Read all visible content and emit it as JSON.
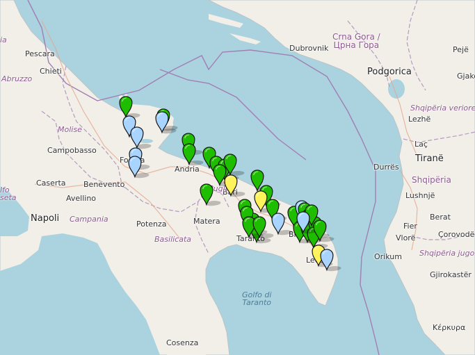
{
  "map": {
    "places": [
      {
        "name": "pescara-label",
        "text": "Pescara",
        "cls": "city"
      },
      {
        "name": "chieti-label",
        "text": "Chieti",
        "cls": "city"
      },
      {
        "name": "campobasso-label",
        "text": "Campobasso",
        "cls": "city"
      },
      {
        "name": "caserta-label",
        "text": "Caserta",
        "cls": "city"
      },
      {
        "name": "benevento-label",
        "text": "Benevento",
        "cls": "city"
      },
      {
        "name": "avellino-label",
        "text": "Avellino",
        "cls": "city"
      },
      {
        "name": "napoli-label",
        "text": "Napoli",
        "cls": "city-big"
      },
      {
        "name": "potenza-label",
        "text": "Potenza",
        "cls": "city"
      },
      {
        "name": "matera-label",
        "text": "Matera",
        "cls": "city"
      },
      {
        "name": "foggia-label",
        "text": "Foggia",
        "cls": "city"
      },
      {
        "name": "andria-label",
        "text": "Andria",
        "cls": "city"
      },
      {
        "name": "bari-label",
        "text": "Bari",
        "cls": "city"
      },
      {
        "name": "taranto-label",
        "text": "Taranto",
        "cls": "city"
      },
      {
        "name": "brindisi-label",
        "text": "Brindisi",
        "cls": "city"
      },
      {
        "name": "lecce-label",
        "text": "Lecce",
        "cls": "city"
      },
      {
        "name": "cosenza-label",
        "text": "Cosenza",
        "cls": "city"
      },
      {
        "name": "dubrovnik-label",
        "text": "Dubrovnik",
        "cls": "city"
      },
      {
        "name": "podgorica-label",
        "text": "Podgorica",
        "cls": "city-big"
      },
      {
        "name": "peje-label",
        "text": "Pejë",
        "cls": "city"
      },
      {
        "name": "gjakove-label",
        "text": "Gjakov",
        "cls": "city"
      },
      {
        "name": "lezhe-label",
        "text": "Lezhë",
        "cls": "city"
      },
      {
        "name": "lac-label",
        "text": "Laç",
        "cls": "city"
      },
      {
        "name": "durres-label",
        "text": "Durrës",
        "cls": "city"
      },
      {
        "name": "tirane-label",
        "text": "Tiranë",
        "cls": "city-big"
      },
      {
        "name": "lushnje-label",
        "text": "Lushnjë",
        "cls": "city"
      },
      {
        "name": "fier-label",
        "text": "Fier",
        "cls": "city"
      },
      {
        "name": "berat-label",
        "text": "Berat",
        "cls": "city"
      },
      {
        "name": "vlore-label",
        "text": "Vlorë",
        "cls": "city"
      },
      {
        "name": "corovode-label",
        "text": "Çorovodë",
        "cls": "city"
      },
      {
        "name": "orikum-label",
        "text": "Orikum",
        "cls": "city"
      },
      {
        "name": "gjirokaster-label",
        "text": "Gjirokastër",
        "cls": "city"
      },
      {
        "name": "kerkyra-label",
        "text": "Κέρκυρα",
        "cls": "city"
      }
    ],
    "regions": [
      {
        "name": "abruzzo-label",
        "text": "Abruzzo"
      },
      {
        "name": "molise-label",
        "text": "Molise"
      },
      {
        "name": "campania-label",
        "text": "Campania"
      },
      {
        "name": "basilicata-label",
        "text": "Basilicata"
      },
      {
        "name": "puglia-label",
        "text": "Puglia"
      },
      {
        "name": "shqiperia-veriore-label",
        "text": "Shqipëria veriore"
      },
      {
        "name": "shqiperia-jugore-label",
        "text": "Shqipëria jugore"
      },
      {
        "name": "lazio-fragment-label",
        "text": "ia"
      },
      {
        "name": "tyrrhenian-fragment-label",
        "text": "lfo\nseta"
      }
    ],
    "countries": [
      {
        "name": "montenegro-label",
        "text": "Crna Gora /\nЦрна Гора"
      },
      {
        "name": "albania-label",
        "text": "Shqipëria"
      }
    ],
    "seas": [
      {
        "name": "gulf-of-taranto-label",
        "text": "Golfo di\nTaranto"
      }
    ],
    "marker_colors": {
      "green": "#1fbd00",
      "lightblue": "#a8d4ff",
      "yellow": "#fff35c"
    },
    "markers": [
      {
        "color": "green"
      },
      {
        "color": "green"
      },
      {
        "color": "lightblue"
      },
      {
        "color": "lightblue"
      },
      {
        "color": "lightblue"
      },
      {
        "color": "lightblue"
      },
      {
        "color": "lightblue"
      },
      {
        "color": "green"
      },
      {
        "color": "green"
      },
      {
        "color": "green"
      },
      {
        "color": "green"
      },
      {
        "color": "green"
      },
      {
        "color": "green"
      },
      {
        "color": "green"
      },
      {
        "color": "green"
      },
      {
        "color": "yellow"
      },
      {
        "color": "green"
      },
      {
        "color": "green"
      },
      {
        "color": "green"
      },
      {
        "color": "yellow"
      },
      {
        "color": "green"
      },
      {
        "color": "green"
      },
      {
        "color": "green"
      },
      {
        "color": "green"
      },
      {
        "color": "green"
      },
      {
        "color": "green"
      },
      {
        "color": "lightblue"
      },
      {
        "color": "green"
      },
      {
        "color": "lightblue"
      },
      {
        "color": "green"
      },
      {
        "color": "green"
      },
      {
        "color": "green"
      },
      {
        "color": "green"
      },
      {
        "color": "green"
      },
      {
        "color": "green"
      },
      {
        "color": "green"
      },
      {
        "color": "lightblue"
      },
      {
        "color": "green"
      },
      {
        "color": "yellow"
      },
      {
        "color": "lightblue"
      }
    ]
  }
}
